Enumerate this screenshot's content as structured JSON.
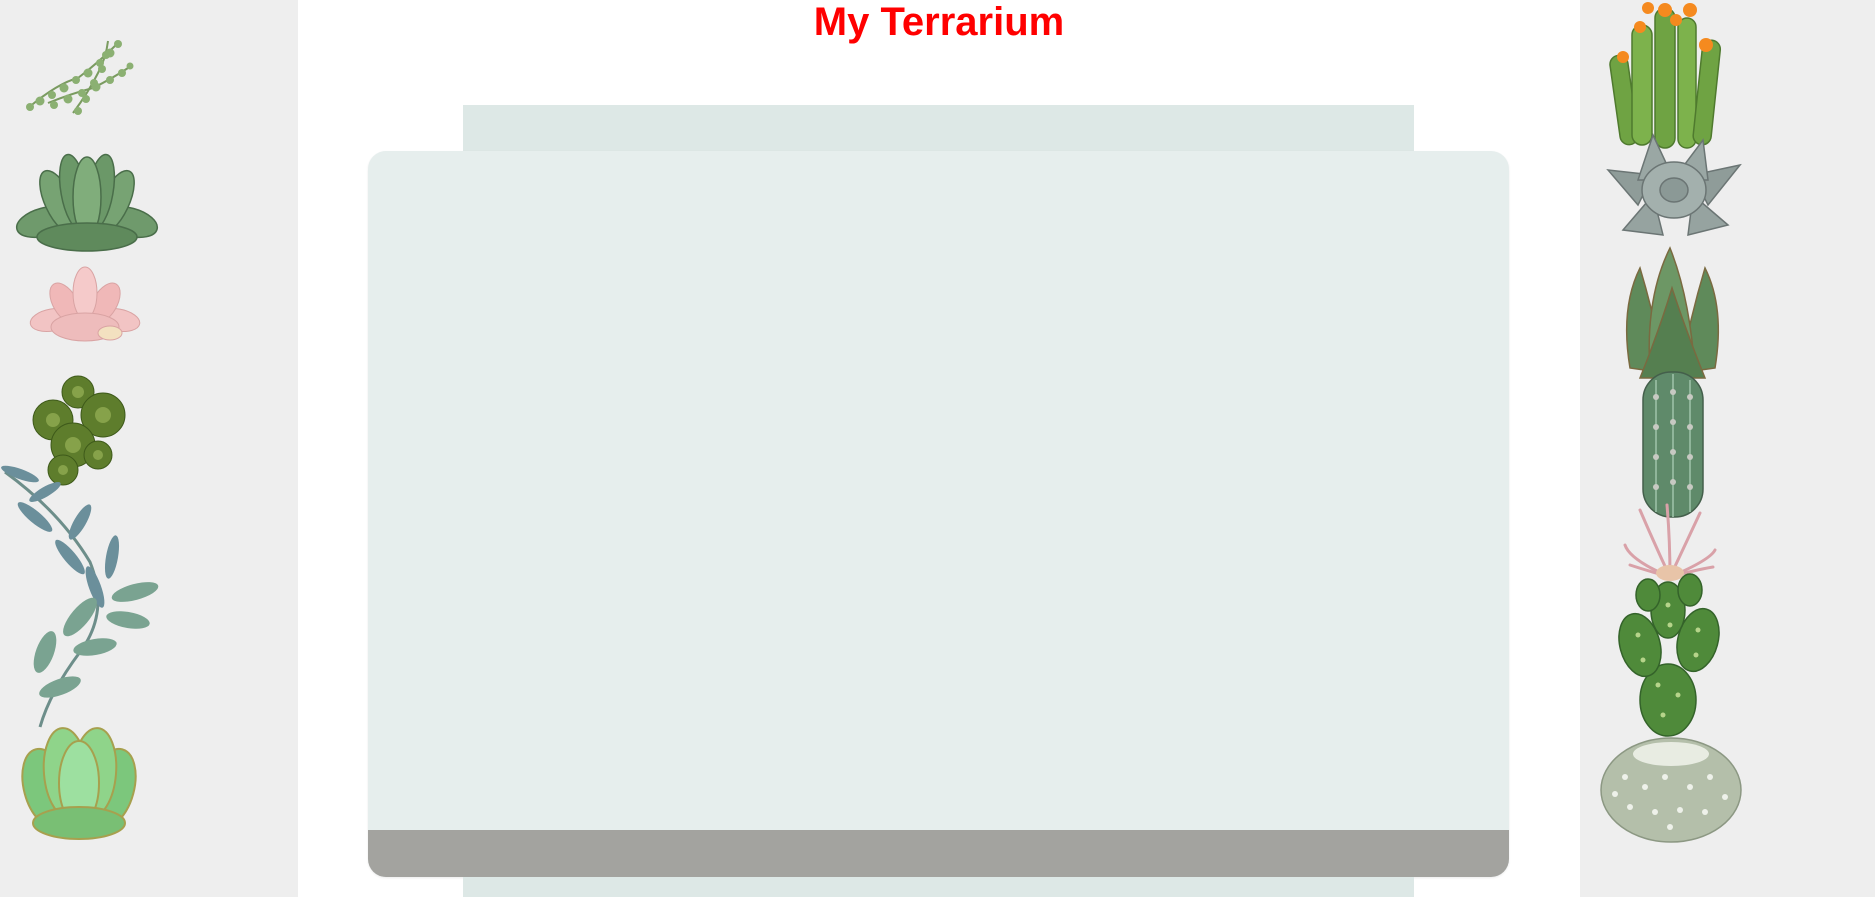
{
  "page": {
    "title": "My Terrarium"
  },
  "colors": {
    "title": "#ff0000",
    "side_panel": "#eeeeee",
    "jar_glass": "#e6eeed",
    "jar_rim": "#dde8e6",
    "soil": "#a3a39f"
  },
  "plants": {
    "left": [
      "string-of-pearls",
      "green-succulent",
      "pink-succulent",
      "dark-green-rosette",
      "eucalyptus-sprig",
      "jade-succulent"
    ],
    "right": [
      "orange-flowering-cactus",
      "silver-succulent",
      "aloe",
      "columnar-cactus",
      "air-plant",
      "prickly-pear-cactus",
      "snowball-cactus"
    ]
  }
}
